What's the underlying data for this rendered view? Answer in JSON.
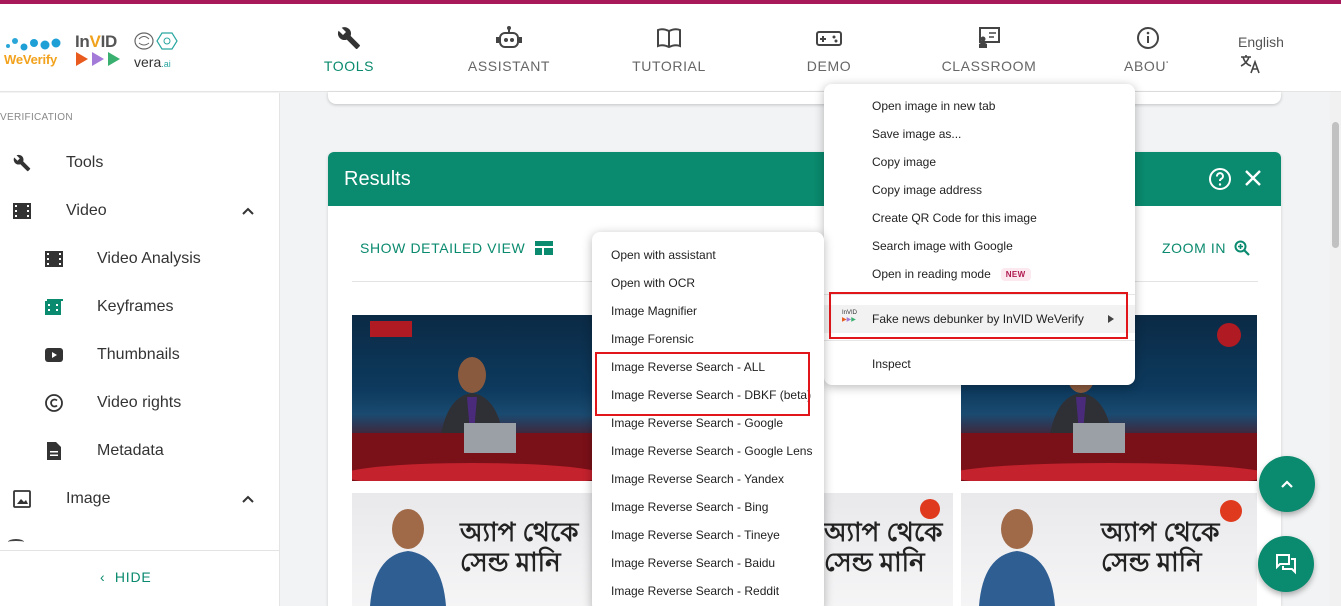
{
  "brand": {
    "weverify": "WeVerify",
    "invid_a": "In",
    "invid_v": "V",
    "invid_b": "ID",
    "vera": "vera",
    "vera_ai": ".ai"
  },
  "nav": [
    {
      "label": "TOOLS",
      "icon": "wrench-icon",
      "active": true
    },
    {
      "label": "ASSISTANT",
      "icon": "robot-icon"
    },
    {
      "label": "TUTORIAL",
      "icon": "book-icon"
    },
    {
      "label": "DEMO",
      "icon": "gamepad-icon"
    },
    {
      "label": "CLASSROOM",
      "icon": "classroom-icon"
    },
    {
      "label": "ABOUT",
      "icon": "info-icon"
    }
  ],
  "language": {
    "label": "English",
    "icon": "translate-icon"
  },
  "sidebar": {
    "section": "VERIFICATION",
    "items": [
      {
        "label": "Tools",
        "icon": "wrench-icon"
      },
      {
        "label": "Video",
        "icon": "film-icon"
      },
      {
        "label": "Video Analysis",
        "icon": "film-icon"
      },
      {
        "label": "Keyframes",
        "icon": "keyframes-icon"
      },
      {
        "label": "Thumbnails",
        "icon": "youtube-icon"
      },
      {
        "label": "Video rights",
        "icon": "copyright-icon"
      },
      {
        "label": "Metadata",
        "icon": "document-icon"
      },
      {
        "label": "Image",
        "icon": "image-icon"
      }
    ],
    "hide_label": "HIDE"
  },
  "results": {
    "title": "Results",
    "show_detailed": "SHOW DETAILED VIEW",
    "zoom_in": "ZOOM IN"
  },
  "context_menu_left": [
    "Open with assistant",
    "Open with OCR",
    "Image Magnifier",
    "Image Forensic",
    "Image Reverse Search - ALL",
    "Image Reverse Search - DBKF (beta)",
    "Image Reverse Search - Google",
    "Image Reverse Search - Google Lens",
    "Image Reverse Search - Yandex",
    "Image Reverse Search - Bing",
    "Image Reverse Search - Tineye",
    "Image Reverse Search - Baidu",
    "Image Reverse Search - Reddit"
  ],
  "context_menu_right": {
    "items": [
      "Open image in new tab",
      "Save image as...",
      "Copy image",
      "Copy image address",
      "Create QR Code for this image",
      "Search image with Google",
      "Open in reading mode"
    ],
    "new_badge": "NEW",
    "extension": "Fake news debunker by InVID  WeVerify",
    "extension_icon_text": "InVID",
    "inspect": "Inspect"
  },
  "thumbnails": {
    "ad_text_line1": "অ্যাপ থেকে",
    "ad_text_line2": "সেন্ড মানি"
  },
  "colors": {
    "accent": "#0a8a6e",
    "stripe": "#a8195a",
    "highlight": "#e0161b"
  }
}
